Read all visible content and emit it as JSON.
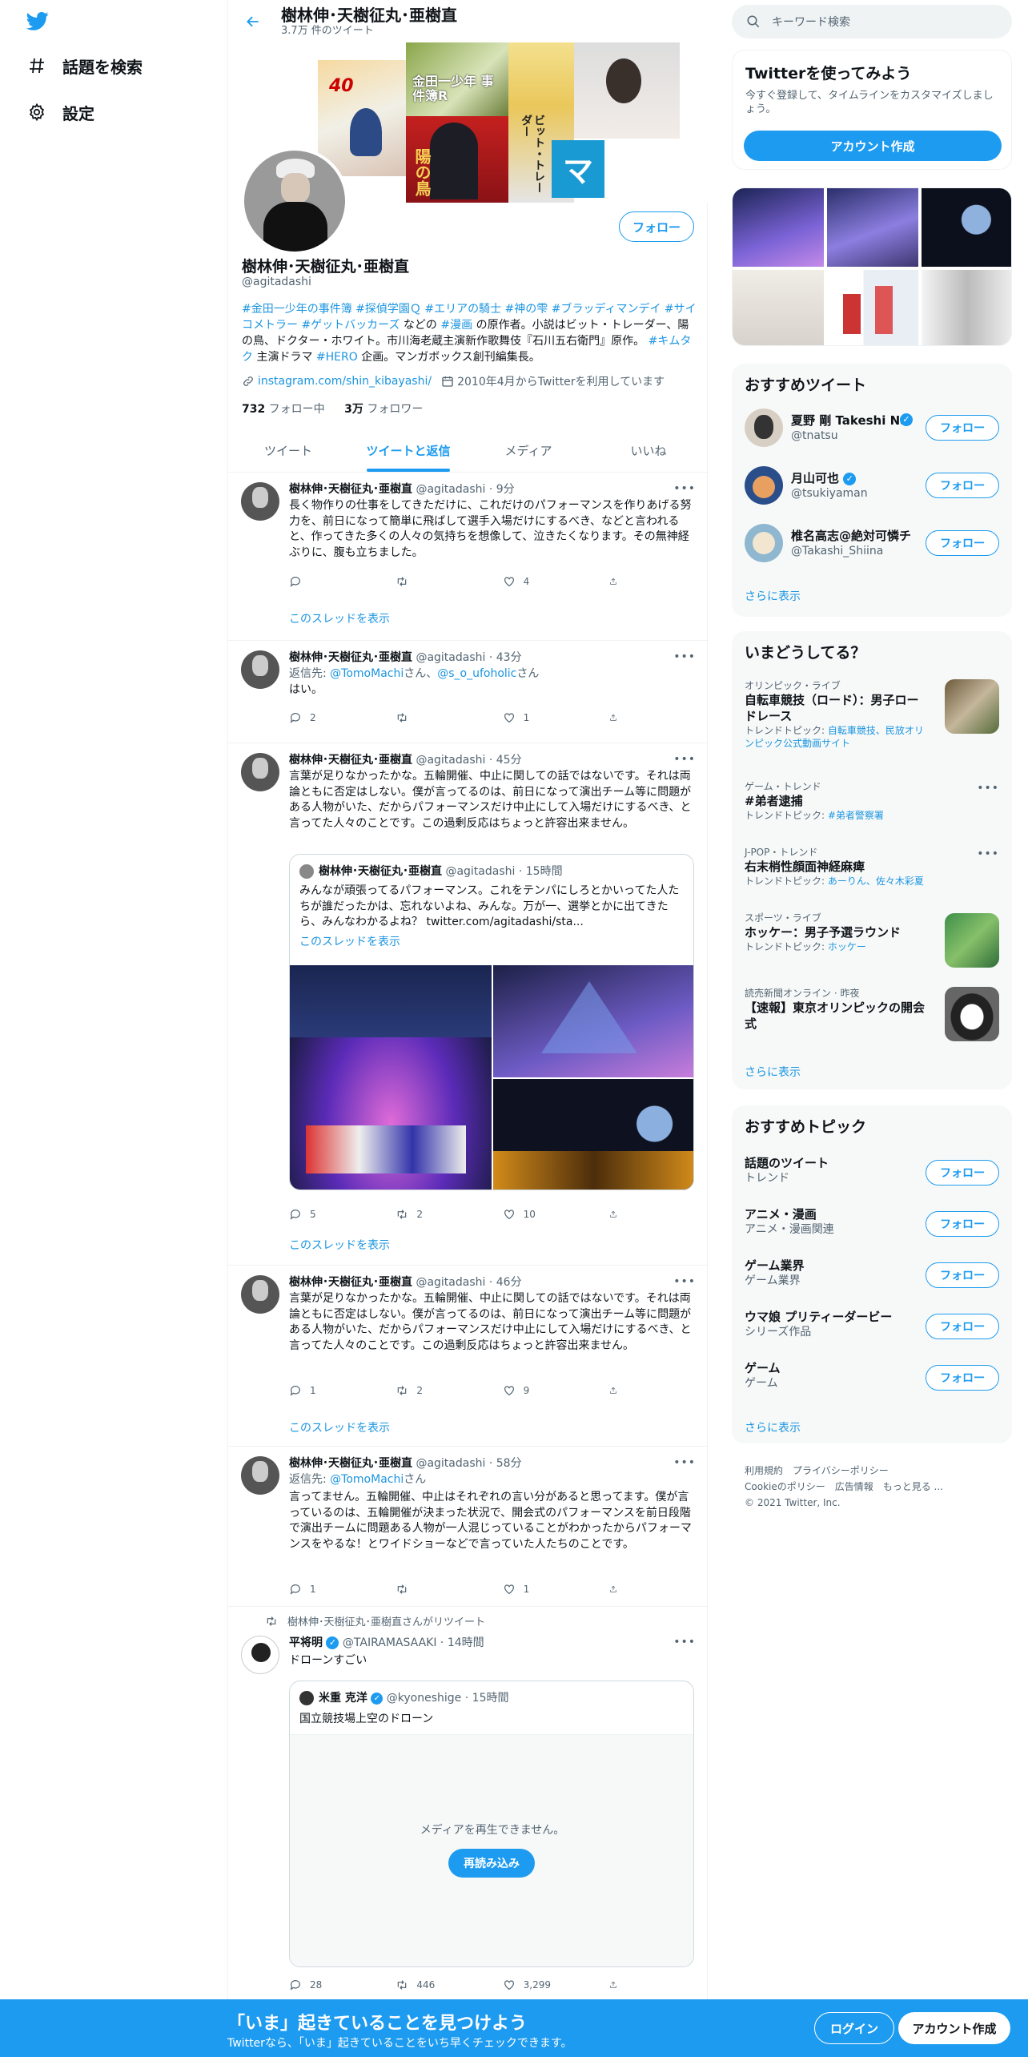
{
  "nav": {
    "explore": "話題を検索",
    "settings": "設定"
  },
  "header": {
    "name": "樹林伸･天樹征丸･亜樹直",
    "tweet_count": "3.7万 件のツイート"
  },
  "profile": {
    "name": "樹林伸･天樹征丸･亜樹直",
    "handle": "@agitadashi",
    "follow": "フォロー",
    "bio_tags1": "#金田一少年の事件簿 #探偵学園Ｑ #エリアの騎士 #神の雫 #ブラッディマンデイ #サイコメトラー #ゲットバッカーズ",
    "bio_mid1": " などの ",
    "bio_tag_manga": "#漫画",
    "bio_mid2": " の原作者。小説はビット・トレーダー、陽の鳥、ドクター・ホワイト。市川海老蔵主演新作歌舞伎『石川五右衛門』原作。 ",
    "bio_tag_kimutaku": "#キムタク",
    "bio_mid3": " 主演ドラマ ",
    "bio_tag_hero": "#HERO",
    "bio_end": " 企画。マンガボックス創刊編集長。",
    "link": "instagram.com/shin_kibayashi/",
    "joined": "2010年4月からTwitterを利用しています",
    "following_count": "732",
    "following_label": " フォロー中",
    "followers_count": "3万",
    "followers_label": " フォロワー"
  },
  "banner": {
    "t1": "40",
    "t2": "金田一少年 事件簿R",
    "t3": "陽の鳥",
    "t4": "ビット・トレーダー",
    "t5": "マ"
  },
  "tabs": [
    "ツイート",
    "ツイートと返信",
    "メディア",
    "いいね"
  ],
  "tweets": [
    {
      "name": "樹林伸･天樹征丸･亜樹直",
      "handle": "@agitadashi",
      "time": "9分",
      "text": "長く物作りの仕事をしてきただけに、これだけのパフォーマンスを作りあげる努力を、前日になって簡単に飛ばして選手入場だけにするべき、などと言われると、作ってきた多くの人々の気持ちを想像して、泣きたくなります。その無神経ぶりに、腹も立ちました。",
      "reply": "",
      "rt": "",
      "like": "4",
      "show": "このスレッドを表示"
    },
    {
      "name": "樹林伸･天樹征丸･亜樹直",
      "handle": "@agitadashi",
      "time": "43分",
      "reply_prefix": "返信先: ",
      "reply_to1": "@TomoMachi",
      "reply_mid": "さん、",
      "reply_to2": "@s_o_ufoholic",
      "reply_end": "さん",
      "text": "はい。",
      "reply": "2",
      "rt": "",
      "like": "1"
    },
    {
      "name": "樹林伸･天樹征丸･亜樹直",
      "handle": "@agitadashi",
      "time": "45分",
      "text": "言葉が足りなかったかな。五輪開催、中止に関しての話ではないです。それは両論ともに否定はしない。僕が言ってるのは、前日になって演出チーム等に問題がある人物がいた、だからパフォーマンスだけ中止にして入場だけにするべき、と言ってた人々のことです。この過剰反応はちょっと許容出来ません。",
      "quote_name": "樹林伸･天樹征丸･亜樹直",
      "quote_handle": "@agitadashi",
      "quote_time": "15時間",
      "quote_text": "みんなが頑張ってるパフォーマンス。これをテンパにしろとかいってた人たちが誰だったかは、忘れないよね、みんな。万が一、選挙とかに出てきたら、みんなわかるよね？ ",
      "quote_link": "twitter.com/agitadashi/sta...",
      "quote_show": "このスレッドを表示",
      "reply": "5",
      "rt": "2",
      "like": "10",
      "show": "このスレッドを表示"
    },
    {
      "name": "樹林伸･天樹征丸･亜樹直",
      "handle": "@agitadashi",
      "time": "46分",
      "text": "言葉が足りなかったかな。五輪開催、中止に関しての話ではないです。それは両論ともに否定はしない。僕が言ってるのは、前日になって演出チーム等に問題がある人物がいた、だからパフォーマンスだけ中止にして入場だけにするべき、と言ってた人々のことです。この過剰反応はちょっと許容出来ません。",
      "reply": "1",
      "rt": "2",
      "like": "9",
      "show": "このスレッドを表示"
    },
    {
      "name": "樹林伸･天樹征丸･亜樹直",
      "handle": "@agitadashi",
      "time": "58分",
      "reply_prefix": "返信先: ",
      "reply_to1": "@TomoMachi",
      "reply_end": "さん",
      "text": "言ってません。五輪開催、中止はそれぞれの言い分があると思ってます。僕が言っているのは、五輪開催が決まった状況で、開会式のパフォーマンスを前日段階で演出チームに問題ある人物が一人混じっていることがわかったからパフォーマンスをやるな！とワイドショーなどで言っていた人たちのことです。",
      "reply": "1",
      "rt": "",
      "like": "1"
    },
    {
      "rt_by": "樹林伸･天樹征丸･亜樹直さんがリツイート",
      "name": "平将明",
      "handle": "@TAIRAMASAAKI",
      "time": "14時間",
      "text": "ドローンすごい",
      "quote_name": "米重 克洋",
      "quote_handle": "@kyoneshige",
      "quote_time": "15時間",
      "quote_text": "国立競技場上空のドローン",
      "media_error": "メディアを再生できません。",
      "reload": "再読み込み",
      "reply": "28",
      "rt": "446",
      "like": "3,299"
    }
  ],
  "right": {
    "search_placeholder": "キーワード検索",
    "signup_title": "Twitterを使ってみよう",
    "signup_desc": "今すぐ登録して、タイムラインをカスタマイズしましょう。",
    "signup_btn": "アカウント作成",
    "recommended_title": "おすすめツイート",
    "recommended": [
      {
        "name": "夏野 剛 Takeshi Natsuno",
        "handle": "@tnatsu"
      },
      {
        "name": "月山可也",
        "handle": "@tsukiyaman"
      },
      {
        "name": "椎名高志@絶対可憐チルドレン",
        "handle": "@Takashi_Shiina"
      }
    ],
    "follow": "フォロー",
    "show_more": "さらに表示",
    "trends_title": "いまどうしてる？",
    "trends": [
      {
        "cat": "オリンピック・ライブ",
        "title": "自転車競技（ロード）：男子ロードレース",
        "topic_prefix": "トレンドトピック: ",
        "topic": "自転車競技、民放オリンピック公式動画サイト"
      },
      {
        "cat": "ゲーム・トレンド",
        "title": "#弟者逮捕",
        "topic_prefix": "トレンドトピック: ",
        "topic": "#弟者警察署"
      },
      {
        "cat": "J-POP・トレンド",
        "title": "右末梢性顔面神経麻痺",
        "topic_prefix": "トレンドトピック: ",
        "topic": "あーりん、佐々木彩夏"
      },
      {
        "cat": "スポーツ・ライブ",
        "title": "ホッケー：男子予選ラウンド",
        "topic_prefix": "トレンドトピック: ",
        "topic": "ホッケー"
      },
      {
        "cat": "読売新聞オンライン · 昨夜",
        "title": "【速報】東京オリンピックの開会式",
        "topic_prefix": "",
        "topic": ""
      }
    ],
    "topics_title": "おすすめトピック",
    "topics": [
      {
        "name": "話題のツイート",
        "sub": "トレンド"
      },
      {
        "name": "アニメ・漫画",
        "sub": "アニメ・漫画関連"
      },
      {
        "name": "ゲーム業界",
        "sub": "ゲーム業界"
      },
      {
        "name": "ウマ娘 プリティーダービー",
        "sub": "シリーズ作品"
      },
      {
        "name": "ゲーム",
        "sub": "ゲーム"
      }
    ],
    "footer1": "利用規約　プライバシーポリシー",
    "footer2": "Cookieのポリシー　広告情報　もっと見る ...",
    "footer3": "© 2021 Twitter, Inc."
  },
  "bottombar": {
    "title": "「いま」起きていることを見つけよう",
    "sub": "Twitterなら、「いま」起きていることをいち早くチェックできます。",
    "login": "ログイン",
    "signup": "アカウント作成"
  },
  "colors": {
    "accent": "#1d9bf0",
    "link": "#1b95e0",
    "text": "#0f1419",
    "secondary": "#536471"
  }
}
